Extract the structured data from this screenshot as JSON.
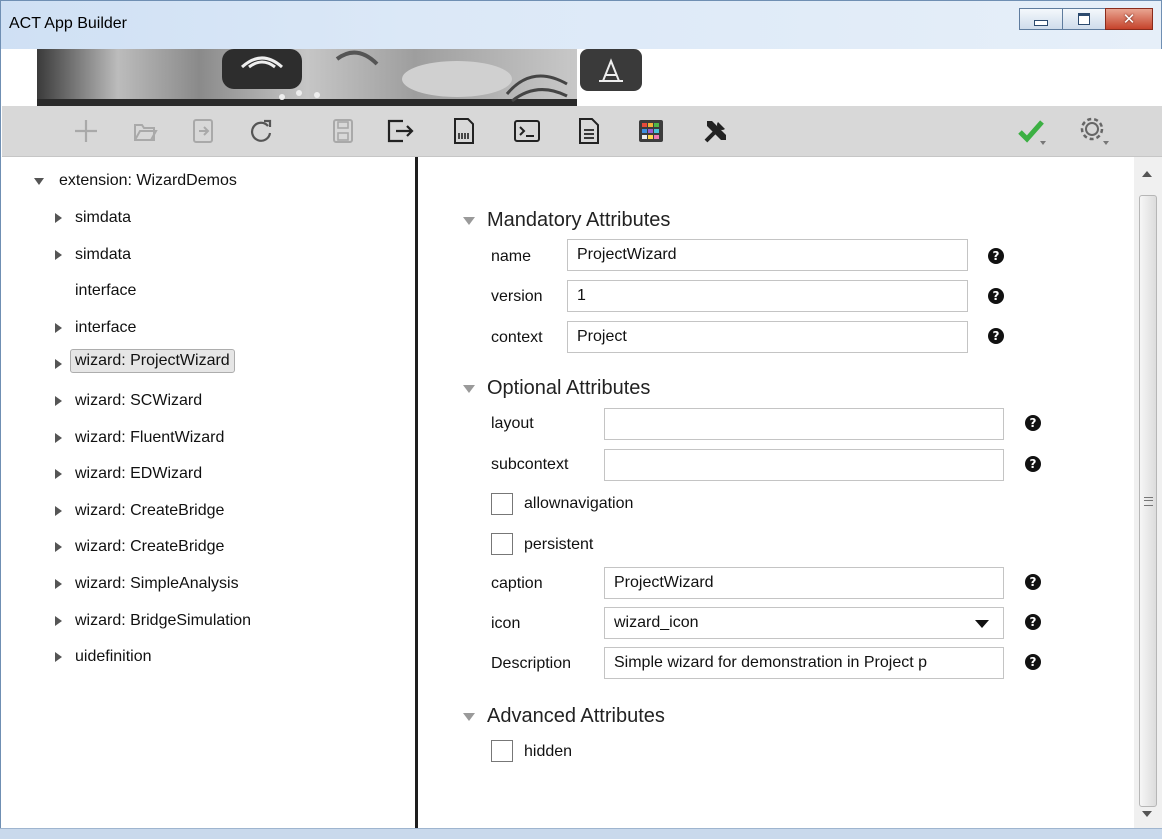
{
  "window": {
    "title": "ACT App Builder"
  },
  "colors": {
    "validate_check": "#3cb043",
    "selected_bg": "#e6e6e6"
  },
  "toolbar": {
    "items": [
      "add-icon",
      "open-icon",
      "import-icon",
      "redo-icon",
      "save-icon",
      "export-icon",
      "build-icon",
      "console-icon",
      "document-icon",
      "palette-icon",
      "tools-icon",
      "validate-check-icon",
      "settings-gear-icon"
    ]
  },
  "tree": {
    "root": "extension: WizardDemos",
    "items": [
      {
        "label": "simdata",
        "expandable": true,
        "selected": false
      },
      {
        "label": "simdata",
        "expandable": true,
        "selected": false
      },
      {
        "label": "interface",
        "expandable": false,
        "selected": false
      },
      {
        "label": "interface",
        "expandable": true,
        "selected": false
      },
      {
        "label": "wizard: ProjectWizard",
        "expandable": true,
        "selected": true
      },
      {
        "label": "wizard: SCWizard",
        "expandable": true,
        "selected": false
      },
      {
        "label": "wizard: FluentWizard",
        "expandable": true,
        "selected": false
      },
      {
        "label": "wizard: EDWizard",
        "expandable": true,
        "selected": false
      },
      {
        "label": "wizard: CreateBridge",
        "expandable": true,
        "selected": false
      },
      {
        "label": "wizard: CreateBridge",
        "expandable": true,
        "selected": false
      },
      {
        "label": "wizard: SimpleAnalysis",
        "expandable": true,
        "selected": false
      },
      {
        "label": "wizard: BridgeSimulation",
        "expandable": true,
        "selected": false
      },
      {
        "label": "uidefinition",
        "expandable": true,
        "selected": false
      }
    ]
  },
  "mandatory": {
    "heading": "Mandatory Attributes",
    "name_label": "name",
    "name_value": "ProjectWizard",
    "version_label": "version",
    "version_value": "1",
    "context_label": "context",
    "context_value": "Project"
  },
  "optional": {
    "heading": "Optional Attributes",
    "layout_label": "layout",
    "layout_value": "",
    "subcontext_label": "subcontext",
    "subcontext_value": "",
    "allownavigation_label": "allownavigation",
    "allownavigation_checked": false,
    "persistent_label": "persistent",
    "persistent_checked": false,
    "caption_label": "caption",
    "caption_value": "ProjectWizard",
    "icon_label": "icon",
    "icon_value": "wizard_icon",
    "description_label": "Description",
    "description_value": "Simple wizard for demonstration in Project p"
  },
  "advanced": {
    "heading": "Advanced Attributes",
    "hidden_label": "hidden",
    "hidden_checked": false
  },
  "help_glyph": "?"
}
